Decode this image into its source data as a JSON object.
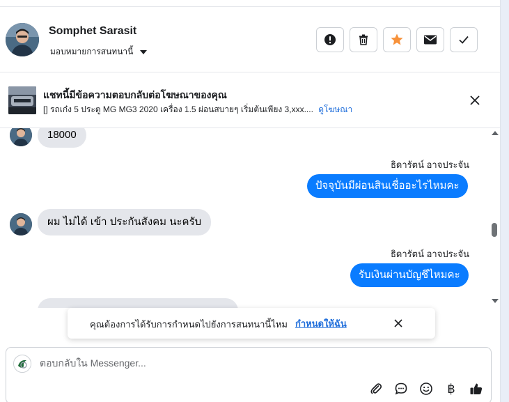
{
  "contact": {
    "name": "Somphet Sarasit",
    "assign_label": "มอบหมายการสนทนานี้"
  },
  "actions": [
    {
      "name": "report-button",
      "icon": "exclamation-icon"
    },
    {
      "name": "delete-button",
      "icon": "trash-icon"
    },
    {
      "name": "star-button",
      "icon": "star-icon"
    },
    {
      "name": "mark-unread-button",
      "icon": "envelope-icon"
    },
    {
      "name": "mark-done-button",
      "icon": "check-icon"
    }
  ],
  "ad_banner": {
    "title": "แชทนี้มีข้อความตอบกลับต่อโฆษณาของคุณ",
    "description": "[] รถเก๋ง 5 ประตู MG MG3 2020 เครื่อง 1.5 ผ่อนสบายๆ เริ่มต้นเพียง 3,xxx....",
    "link_label": "ดูโฆษณา"
  },
  "messages": {
    "m1": "18000",
    "sender1": "ธิดารัตน์ อาจประจัน",
    "m2": "ปัจจุบันมีผ่อนสินเชื่ออะไรไหมคะ",
    "m3": "ผม ไม่ได้ เข้า ประกันสังคม นะครับ",
    "sender2": "ธิดารัตน์ อาจประจัน",
    "m4": "รับเงินผ่านบัญชีไหมคะ"
  },
  "toast": {
    "text": "คุณต้องการได้รับการกำหนดไปยังการสนทนานี้ไหม",
    "link_label": "กำหนดให้ฉัน"
  },
  "composer": {
    "placeholder": "ตอบกลับใน Messenger...",
    "currency_symbol": "฿"
  },
  "colors": {
    "accent": "#0a7cff",
    "star": "#f7923b",
    "link": "#216fdb"
  }
}
